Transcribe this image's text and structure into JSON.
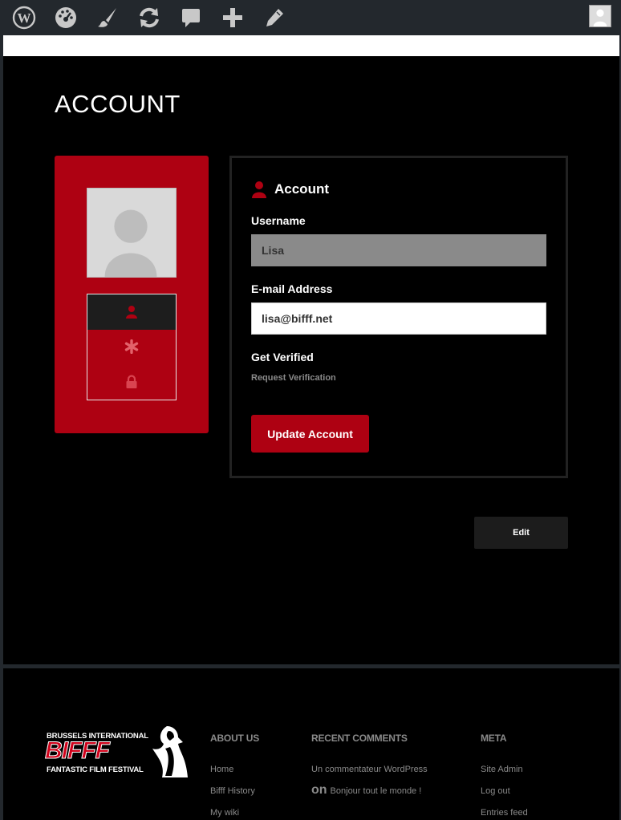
{
  "admin_bar": {
    "icons": [
      "wordpress-icon",
      "dashboard-icon",
      "customize-brush-icon",
      "updates-icon",
      "comments-icon",
      "new-content-icon",
      "edit-icon"
    ],
    "avatar": "user-avatar"
  },
  "page": {
    "title": "ACCOUNT"
  },
  "sidebar_tabs": [
    {
      "name": "account-tab",
      "icon": "user-icon",
      "active": true
    },
    {
      "name": "password-tab",
      "icon": "asterisk-icon",
      "active": false
    },
    {
      "name": "privacy-tab",
      "icon": "lock-icon",
      "active": false
    }
  ],
  "account_form": {
    "heading": "Account",
    "username_label": "Username",
    "username_value": "Lisa",
    "email_label": "E-mail Address",
    "email_value": "lisa@bifff.net",
    "verified_label": "Get Verified",
    "verify_link": "Request Verification",
    "update_button": "Update Account"
  },
  "edit_button": "Edit",
  "footer": {
    "logo": {
      "line1": "BRUSSELS INTERNATIONAL",
      "line2": "BIFFF",
      "line3": "FANTASTIC FILM FESTIVAL"
    },
    "about": {
      "title": "ABOUT US",
      "links": [
        "Home",
        "Bifff History",
        "My wiki"
      ]
    },
    "recent_comments": {
      "title": "RECENT COMMENTS",
      "author": "Un commentateur WordPress",
      "on": "on",
      "post": "Bonjour tout le monde !"
    },
    "meta": {
      "title": "META",
      "links": [
        "Site Admin",
        "Log out",
        "Entries feed"
      ]
    }
  },
  "colors": {
    "accent_red": "#ae0112",
    "admin_bar": "#23282d",
    "background": "#000000"
  }
}
